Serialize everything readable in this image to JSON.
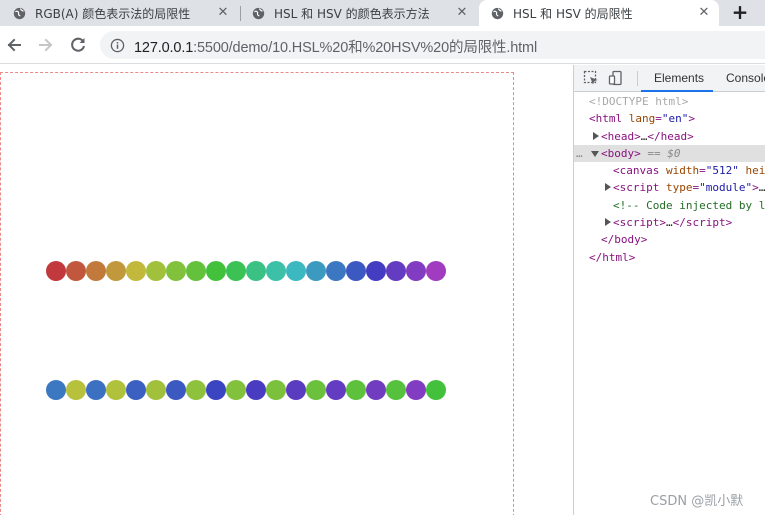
{
  "tabs": [
    {
      "title": "RGB(A) 颜色表示法的局限性",
      "close": "✕",
      "active": false
    },
    {
      "title": "HSL 和 HSV 的颜色表示方法",
      "close": "✕",
      "active": false
    },
    {
      "title": "HSL 和 HSV 的局限性",
      "close": "✕",
      "active": true
    }
  ],
  "new_tab": "+",
  "address": {
    "host": "127.0.0.1",
    "rest": ":5500/demo/10.HSL%20和%20HSV%20的局限性.html"
  },
  "rows": [
    {
      "name": "top-row",
      "colors": [
        "#c1393c",
        "#c1573c",
        "#c17a3c",
        "#c1993c",
        "#c1b83c",
        "#a1c13c",
        "#82c13c",
        "#63c13c",
        "#44c13c",
        "#3cc155",
        "#3cc185",
        "#3cc1a8",
        "#3cb8c1",
        "#3c9ac1",
        "#3c77c1",
        "#3c58c1",
        "#443cc1",
        "#633cc1",
        "#823cc1",
        "#a13cc1"
      ]
    },
    {
      "name": "bottom-row",
      "colors": [
        "#3c77c1",
        "#b8c13c",
        "#3c70c1",
        "#b0c13c",
        "#3c60c1",
        "#a1c13c",
        "#3c58c1",
        "#8ec13c",
        "#3c45c1",
        "#82c13c",
        "#4a3cc1",
        "#7bc13c",
        "#5a3cc1",
        "#6bc13c",
        "#633cc1",
        "#5ec13c",
        "#723cc1",
        "#55c13c",
        "#823cc1",
        "#44c13c"
      ]
    }
  ],
  "devtools": {
    "tabs": [
      "Elements",
      "Console"
    ],
    "dom": {
      "doctype": "<!DOCTYPE html>",
      "html_open_tag": "html",
      "html_attr": "lang",
      "html_val": "\"en\"",
      "head": "head",
      "head_ellipsis": "…",
      "body_prefix": "…",
      "body_tag": "body",
      "body_suffix": " == $0",
      "canvas_tag": "canvas",
      "canvas_attr": "width",
      "canvas_val": "\"512\"",
      "canvas_rest": " heig",
      "script1_tag": "script",
      "script1_attr": "type",
      "script1_val": "\"module\"",
      "script1_rest": "…",
      "comment": "<!-- Code injected by l",
      "script2_tag": "script",
      "script2_rest": "…",
      "body_close": "/body",
      "html_close": "/html"
    }
  },
  "watermark": "CSDN @凯小默"
}
